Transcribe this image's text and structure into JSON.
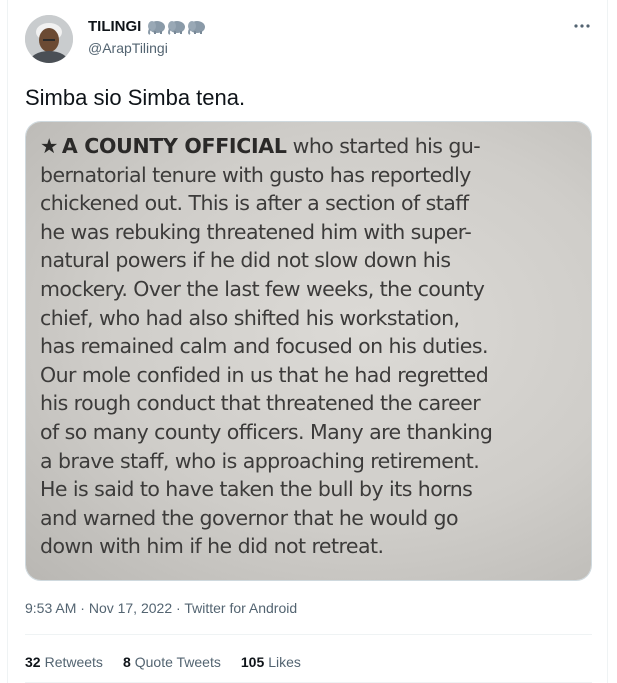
{
  "author": {
    "display_name": "TILINGI",
    "handle": "@ArapTilingi",
    "name_emoji": [
      "elephant-emoji",
      "elephant-emoji",
      "elephant-emoji"
    ]
  },
  "tweet": {
    "text": "Simba sio Simba tena."
  },
  "clipping": {
    "heading": "A COUNTY OFFICIAL",
    "first_line_rest": " who started his gu-",
    "lines": [
      "bernatorial tenure with gusto has reportedly",
      "chickened out. This is after a section of staff",
      "he was rebuking threatened him with super-",
      "natural powers if he did not slow down his",
      "mockery. Over the last few weeks, the county",
      "chief, who had also shifted his workstation,",
      "has remained calm and focused on his duties.",
      "Our mole confided in us that he had regretted",
      "his rough conduct that threatened the career",
      "of so many county officers. Many are thanking",
      "a brave staff, who is approaching retirement.",
      "He is said to have taken the bull by its horns",
      "and warned the governor that he would go",
      "down with him if he did not retreat."
    ]
  },
  "meta": {
    "time": "9:53 AM",
    "separator": "·",
    "date": "Nov 17, 2022",
    "client": "Twitter for Android"
  },
  "stats": {
    "retweets_count": "32",
    "retweets_label": "Retweets",
    "quotes_count": "8",
    "quotes_label": "Quote Tweets",
    "likes_count": "105",
    "likes_label": "Likes"
  },
  "colors": {
    "text_primary": "#0f1419",
    "text_secondary": "#536471",
    "border": "#cfd9de"
  },
  "icons": {
    "more": "more-horizontal-icon",
    "clipping_marker": "star-icon"
  }
}
